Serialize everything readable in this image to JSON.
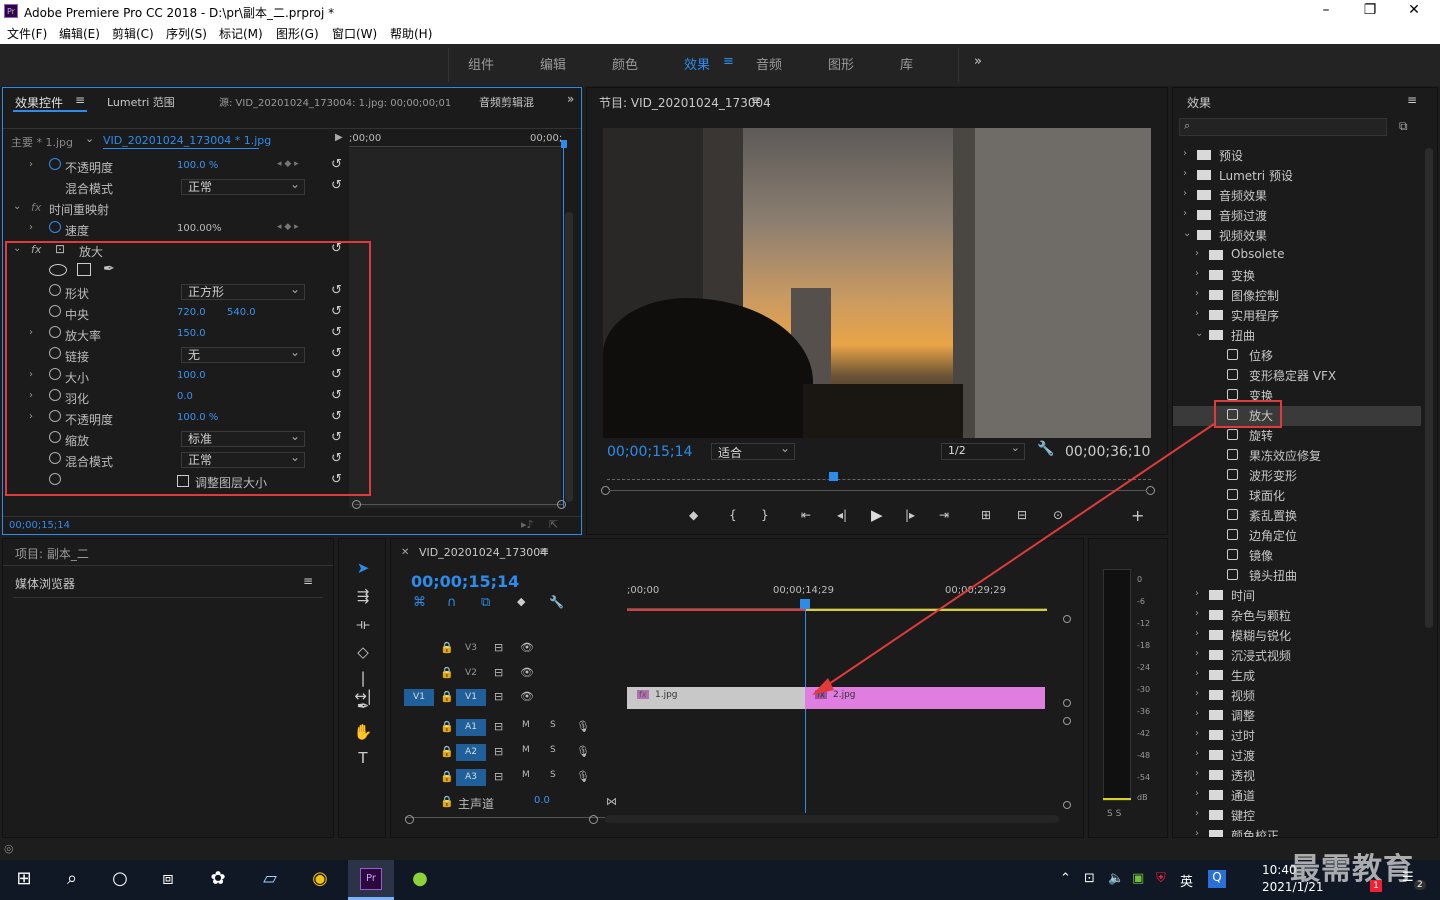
{
  "title": "Adobe Premiere Pro CC 2018 - D:\\pr\\副本_二.prproj *",
  "app_icon": "Pr",
  "menus": [
    "文件(F)",
    "编辑(E)",
    "剪辑(C)",
    "序列(S)",
    "标记(M)",
    "图形(G)",
    "窗口(W)",
    "帮助(H)"
  ],
  "workspaces": [
    "组件",
    "编辑",
    "颜色",
    "效果",
    "音频",
    "图形",
    "库"
  ],
  "ws_more": "»",
  "effect_controls": {
    "tabs": [
      "效果控件",
      "Lumetri 范围",
      "源: VID_20201024_173004: 1.jpg: 00;00;00;01",
      "音频剪辑混"
    ],
    "master": "主要 * 1.jpg",
    "clip": "VID_20201024_173004 * 1.jpg",
    "tl_start": ";00;00",
    "tl_end": "00;00;",
    "rows": [
      {
        "label": "不透明度",
        "value": "100.0 %"
      },
      {
        "label": "混合模式",
        "value": "正常"
      },
      {
        "label": "时间重映射",
        "value": ""
      },
      {
        "label": "速度",
        "value": "100.00%"
      },
      {
        "label": "放大",
        "value": ""
      },
      {
        "label": "形状",
        "value": "正方形"
      },
      {
        "label": "中央",
        "value": "720.0",
        "value2": "540.0"
      },
      {
        "label": "放大率",
        "value": "150.0"
      },
      {
        "label": "链接",
        "value": "无"
      },
      {
        "label": "大小",
        "value": "100.0"
      },
      {
        "label": "羽化",
        "value": "0.0"
      },
      {
        "label": "不透明度",
        "value": "100.0 %"
      },
      {
        "label": "缩放",
        "value": "标准"
      },
      {
        "label": "混合模式",
        "value": "正常"
      },
      {
        "label": "调整图层大小",
        "value": ""
      }
    ],
    "timecode": "00;00;15;14"
  },
  "program": {
    "title": "节目: VID_20201024_173004",
    "timecode": "00;00;15;14",
    "fit": "适合",
    "res": "1/2",
    "duration": "00;00;36;10"
  },
  "project": {
    "title": "项目: 副本_二",
    "media": "媒体浏览器"
  },
  "timeline": {
    "title": "VID_20201024_173004",
    "timecode": "00;00;15;14",
    "rulers": [
      ";00;00",
      "00;00;14;29",
      "00;00;29;29"
    ],
    "video_tracks": [
      "V3",
      "V2",
      "V1"
    ],
    "src_label": "V1",
    "audio_tracks": [
      "A1",
      "A2",
      "A3"
    ],
    "master": "主声道",
    "master_val": "0.0",
    "clips": [
      "1.jpg",
      "2.jpg"
    ],
    "m": "M",
    "s": "S"
  },
  "meter": {
    "ticks": [
      "0",
      "-6",
      "-12",
      "-18",
      "-24",
      "-30",
      "-36",
      "-42",
      "-48",
      "-54",
      "dB"
    ],
    "solo": "S S"
  },
  "effects": {
    "title": "效果",
    "items": [
      {
        "label": "预设",
        "level": 0,
        "kind": "fold",
        "arrow": "›"
      },
      {
        "label": "Lumetri 预设",
        "level": 0,
        "kind": "fold",
        "arrow": "›"
      },
      {
        "label": "音频效果",
        "level": 0,
        "kind": "fold",
        "arrow": "›"
      },
      {
        "label": "音频过渡",
        "level": 0,
        "kind": "fold",
        "arrow": "›"
      },
      {
        "label": "视频效果",
        "level": 0,
        "kind": "fold",
        "arrow": "⌄"
      },
      {
        "label": "Obsolete",
        "level": 1,
        "kind": "fold",
        "arrow": "›"
      },
      {
        "label": "变换",
        "level": 1,
        "kind": "fold",
        "arrow": "›"
      },
      {
        "label": "图像控制",
        "level": 1,
        "kind": "fold",
        "arrow": "›"
      },
      {
        "label": "实用程序",
        "level": 1,
        "kind": "fold",
        "arrow": "›"
      },
      {
        "label": "扭曲",
        "level": 1,
        "kind": "fold",
        "arrow": "⌄"
      },
      {
        "label": "位移",
        "level": 2,
        "kind": "fx",
        "arrow": ""
      },
      {
        "label": "变形稳定器 VFX",
        "level": 2,
        "kind": "fx",
        "arrow": ""
      },
      {
        "label": "变换",
        "level": 2,
        "kind": "fx",
        "arrow": ""
      },
      {
        "label": "放大",
        "level": 2,
        "kind": "fx",
        "arrow": "",
        "selected": true
      },
      {
        "label": "旋转",
        "level": 2,
        "kind": "fx",
        "arrow": ""
      },
      {
        "label": "果冻效应修复",
        "level": 2,
        "kind": "fx",
        "arrow": ""
      },
      {
        "label": "波形变形",
        "level": 2,
        "kind": "fx",
        "arrow": ""
      },
      {
        "label": "球面化",
        "level": 2,
        "kind": "fx",
        "arrow": ""
      },
      {
        "label": "紊乱置换",
        "level": 2,
        "kind": "fx",
        "arrow": ""
      },
      {
        "label": "边角定位",
        "level": 2,
        "kind": "fx",
        "arrow": ""
      },
      {
        "label": "镜像",
        "level": 2,
        "kind": "fx",
        "arrow": ""
      },
      {
        "label": "镜头扭曲",
        "level": 2,
        "kind": "fx",
        "arrow": ""
      },
      {
        "label": "时间",
        "level": 1,
        "kind": "fold",
        "arrow": "›"
      },
      {
        "label": "杂色与颗粒",
        "level": 1,
        "kind": "fold",
        "arrow": "›"
      },
      {
        "label": "模糊与锐化",
        "level": 1,
        "kind": "fold",
        "arrow": "›"
      },
      {
        "label": "沉浸式视频",
        "level": 1,
        "kind": "fold",
        "arrow": "›"
      },
      {
        "label": "生成",
        "level": 1,
        "kind": "fold",
        "arrow": "›"
      },
      {
        "label": "视频",
        "level": 1,
        "kind": "fold",
        "arrow": "›"
      },
      {
        "label": "调整",
        "level": 1,
        "kind": "fold",
        "arrow": "›"
      },
      {
        "label": "过时",
        "level": 1,
        "kind": "fold",
        "arrow": "›"
      },
      {
        "label": "过渡",
        "level": 1,
        "kind": "fold",
        "arrow": "›"
      },
      {
        "label": "透视",
        "level": 1,
        "kind": "fold",
        "arrow": "›"
      },
      {
        "label": "通道",
        "level": 1,
        "kind": "fold",
        "arrow": "›"
      },
      {
        "label": "键控",
        "level": 1,
        "kind": "fold",
        "arrow": "›"
      },
      {
        "label": "颜色校正",
        "level": 1,
        "kind": "fold",
        "arrow": "›"
      }
    ]
  },
  "taskbar": {
    "time": "10:40",
    "date": "2021/1/21",
    "ime": "英",
    "watermark": "最需教育",
    "notif": "2",
    "badge": "1"
  },
  "colors": {
    "accent": "#2d8ceb",
    "highlight": "#e03a3a",
    "clip_gray": "#c8c8c8",
    "clip_pink": "#e07de0"
  }
}
